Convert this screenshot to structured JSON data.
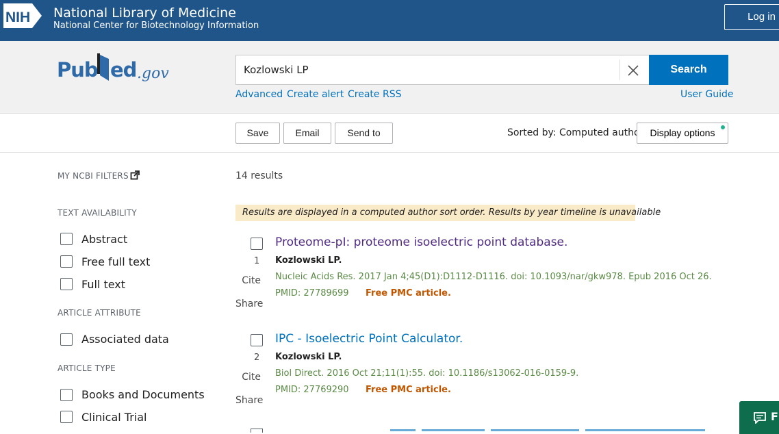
{
  "nih": {
    "logo_text": "NIH",
    "title": "National Library of Medicine",
    "subtitle": "National Center for Biotechnology Information",
    "login_label": "Log in"
  },
  "search": {
    "logo_text": "PubMed.gov",
    "query": "Kozlowski LP",
    "button_label": "Search",
    "links": {
      "advanced": "Advanced",
      "create_alert": "Create alert",
      "create_rss": "Create RSS",
      "user_guide": "User Guide"
    }
  },
  "toolbar": {
    "save_label": "Save",
    "email_label": "Email",
    "send_to_label": "Send to",
    "sorted_by": "Sorted by: Computed author",
    "display_options_label": "Display options"
  },
  "sidebar": {
    "my_ncbi_filters": "MY NCBI FILTERS",
    "sections": [
      {
        "heading": "TEXT AVAILABILITY",
        "items": [
          "Abstract",
          "Free full text",
          "Full text"
        ]
      },
      {
        "heading": "ARTICLE ATTRIBUTE",
        "items": [
          "Associated data"
        ]
      },
      {
        "heading": "ARTICLE TYPE",
        "items": [
          "Books and Documents",
          "Clinical Trial"
        ]
      }
    ]
  },
  "results": {
    "count_text": "14 results",
    "notice": "Results are displayed in a computed author sort order. Results by year timeline is unavailable",
    "cite_label": "Cite",
    "share_label": "Share",
    "items": [
      {
        "number": "1",
        "title": "Proteome-pI: proteome isoelectric point database.",
        "authors": "Kozlowski LP.",
        "citation": "Nucleic Acids Res. 2017 Jan 4;45(D1):D1112-D1116. doi: 10.1093/nar/gkw978. Epub 2016 Oct 26.",
        "pmid": "PMID: 27789699",
        "free": "Free PMC article."
      },
      {
        "number": "2",
        "title": "IPC - Isoelectric Point Calculator.",
        "authors": "Kozlowski LP.",
        "citation": "Biol Direct. 2016 Oct 21;11(1):55. doi: 10.1186/s13062-016-0159-9.",
        "pmid": "PMID: 27769290",
        "free": "Free PMC article."
      }
    ]
  },
  "feedback": {
    "label": "F"
  },
  "colors": {
    "nih_blue": "#20558a",
    "link_blue": "#0071bc",
    "visited_purple": "#4f2a82",
    "citation_green": "#5a8a45",
    "free_orange": "#c05600",
    "notice_bg": "#faebc8",
    "feedback_green": "#0d6d4c"
  }
}
